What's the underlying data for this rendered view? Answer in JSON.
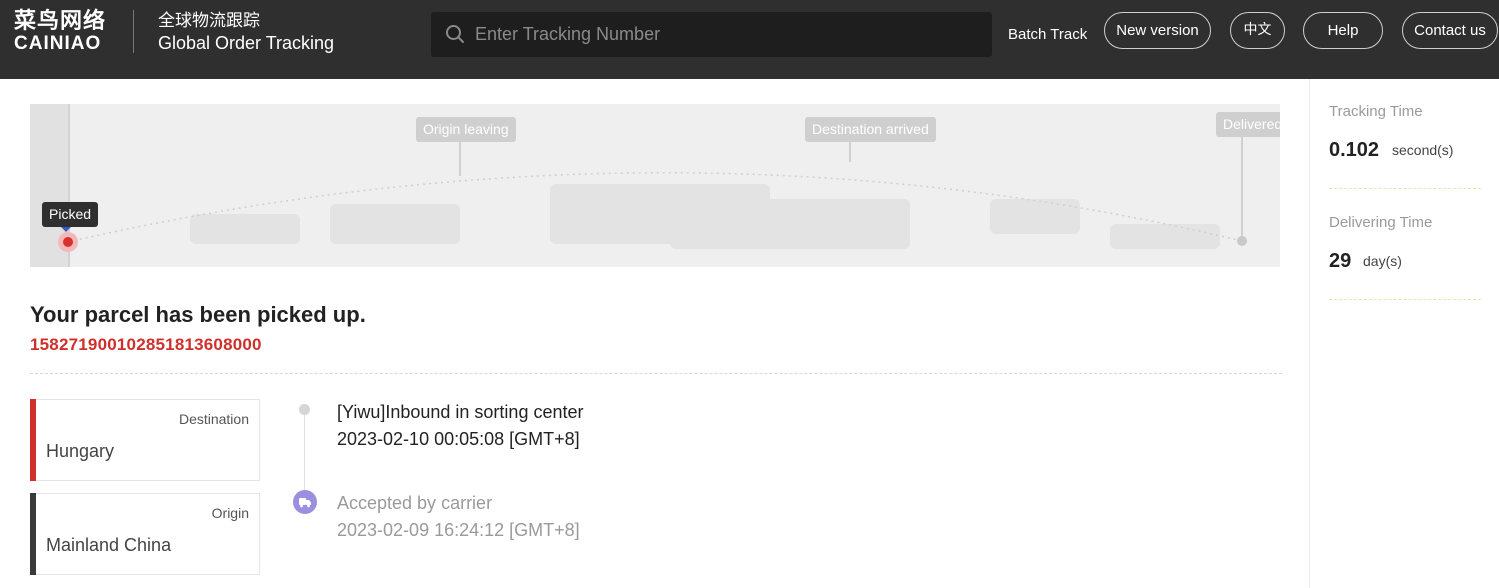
{
  "header": {
    "logo_cn": "菜鸟网络",
    "logo_en": "CAINIAO",
    "brand_cn": "全球物流跟踪",
    "brand_en": "Global Order Tracking",
    "search_placeholder": "Enter Tracking Number",
    "search_icon": "search-icon",
    "batch_track": "Batch Track",
    "new_version": "New version",
    "language": "中文",
    "help": "Help",
    "contact_us": "Contact us"
  },
  "progress_map": {
    "current_stage": "Picked",
    "milestones": [
      "Origin leaving",
      "Destination arrived",
      "Delivered"
    ]
  },
  "parcel": {
    "status_title": "Your parcel has been picked up.",
    "tracking_number": "15827190010285181360800​0"
  },
  "locations": {
    "destination_label": "Destination",
    "destination_value": "Hungary",
    "origin_label": "Origin",
    "origin_value": "Mainland China"
  },
  "events": [
    {
      "description": "[Yiwu]Inbound in sorting center",
      "time": "2023-02-10 00:05:08 [GMT+8]"
    },
    {
      "description": "Accepted by carrier",
      "time": "2023-02-09 16:24:12 [GMT+8]",
      "icon": "truck-icon"
    }
  ],
  "sidebar": {
    "tracking_time_label": "Tracking Time",
    "tracking_time_value": "0.102",
    "tracking_time_unit": "second(s)",
    "delivering_time_label": "Delivering Time",
    "delivering_time_value": "29",
    "delivering_time_unit": "day(s)"
  },
  "colors": {
    "header_bg": "#2f2f2f",
    "accent_red": "#d0302b",
    "timeline_truck": "#9b8fe0"
  }
}
